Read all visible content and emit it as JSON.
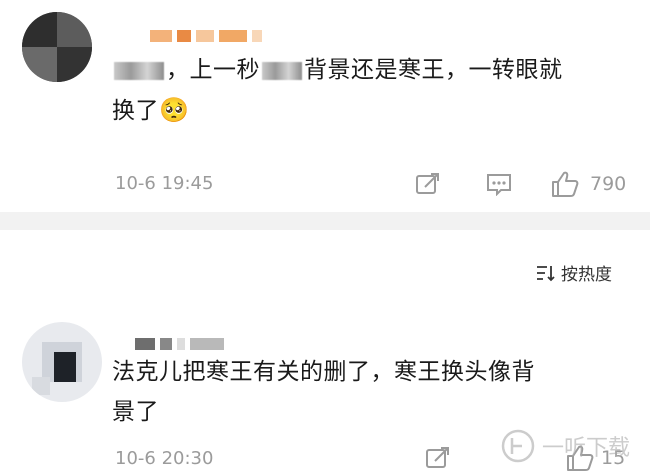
{
  "comments": [
    {
      "text_after_blur": "，上一秒",
      "text_after_blur2": "背景还是寒王，一转眼就",
      "line2": "换了",
      "emoji": "🥺",
      "time": "10-6 19:45",
      "like_count": "790"
    },
    {
      "line1": "法克儿把寒王有关的删了，寒王换头像背",
      "line2": "景了",
      "time": "10-6 20:30",
      "like_count": "15"
    }
  ],
  "sort_label": "按热度",
  "watermark_text": "一听下载",
  "colors": {
    "muted": "#9b9b9b",
    "divider": "#f2f2f2",
    "name_blur_orange": "#f0a050"
  }
}
